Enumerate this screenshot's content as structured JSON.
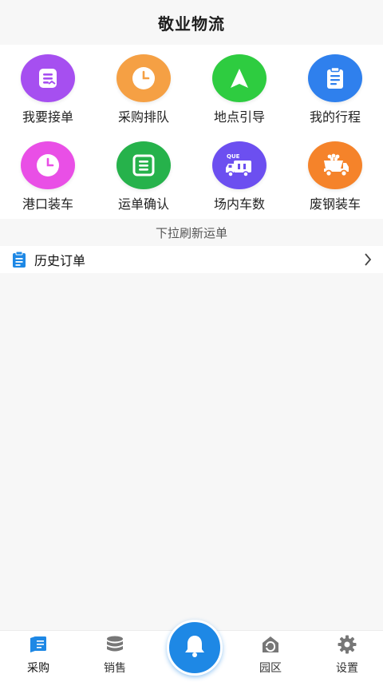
{
  "header": {
    "title": "敬业物流"
  },
  "grid": {
    "items": [
      {
        "label": "我要接单",
        "icon": "order-accept-icon",
        "color": "#a64ff0"
      },
      {
        "label": "采购排队",
        "icon": "clock-icon",
        "color": "#f5a044"
      },
      {
        "label": "地点引导",
        "icon": "navigation-arrow-icon",
        "color": "#2ecc40"
      },
      {
        "label": "我的行程",
        "icon": "clipboard-icon",
        "color": "#2f80ed"
      },
      {
        "label": "港口装车",
        "icon": "clock-icon",
        "color": "#e94fe6"
      },
      {
        "label": "运单确认",
        "icon": "waybill-confirm-icon",
        "color": "#26b24b"
      },
      {
        "label": "场内车数",
        "icon": "queue-truck-icon",
        "icon_text": "QUE",
        "color": "#6c4ff0"
      },
      {
        "label": "废钢装车",
        "icon": "dump-truck-icon",
        "color": "#f5832a"
      }
    ]
  },
  "pull_hint": "下拉刷新运单",
  "history": {
    "label": "历史订单",
    "icon": "clipboard-icon",
    "color": "#1e88e5"
  },
  "tabbar": {
    "active_color": "#1e88e5",
    "tabs": [
      {
        "label": "采购",
        "icon": "purchase-book-icon",
        "active": true
      },
      {
        "label": "销售",
        "icon": "database-stack-icon",
        "active": false
      },
      {
        "label": "园区",
        "icon": "park-home-icon",
        "active": false
      },
      {
        "label": "设置",
        "icon": "gear-icon",
        "active": false
      }
    ],
    "center": {
      "icon": "bell-icon",
      "color": "#1e88e5"
    }
  }
}
